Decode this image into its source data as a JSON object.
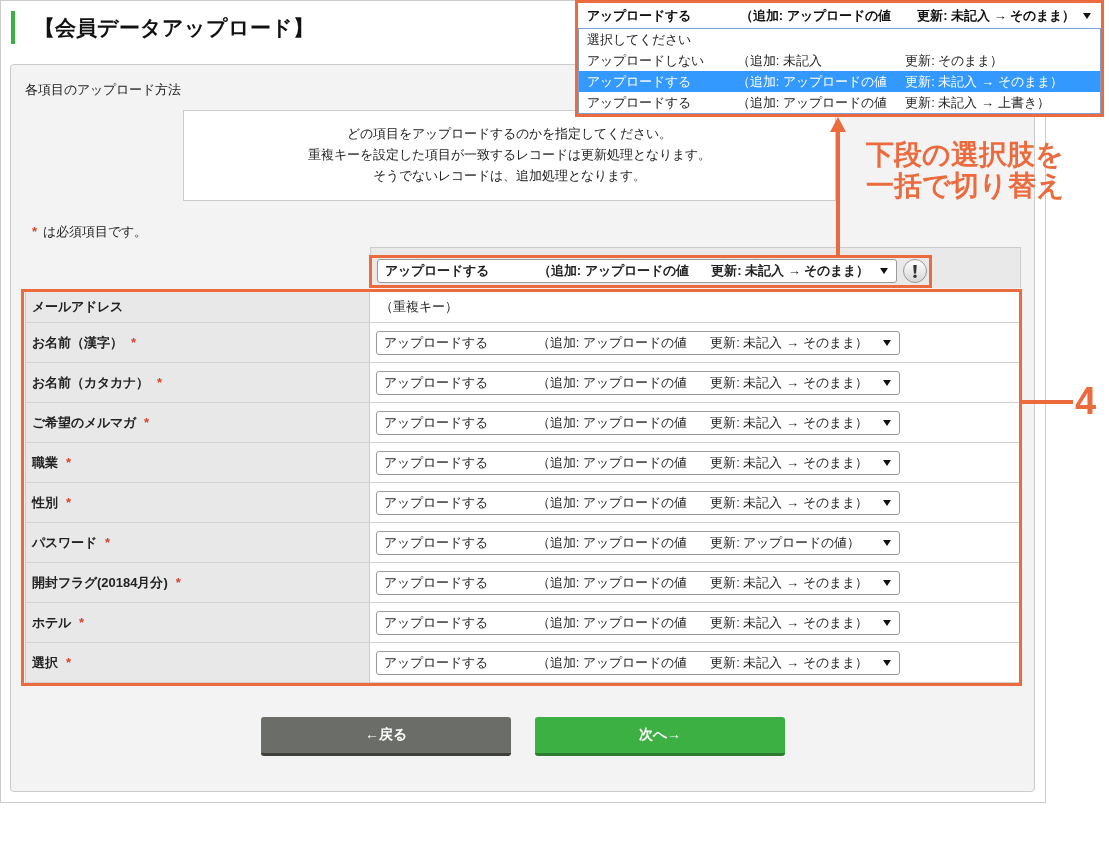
{
  "page_title": "【会員データアップロード】",
  "dropdown_popup": {
    "value_parts": [
      "アップロードする",
      "（追加: アップロードの値",
      "更新: 未記入 → そのまま）"
    ],
    "options": [
      {
        "parts": [
          "選択してください"
        ],
        "selected": false
      },
      {
        "parts": [
          "アップロードしない",
          "（追加: 未記入",
          "更新: そのまま）"
        ],
        "selected": false
      },
      {
        "parts": [
          "アップロードする",
          "（追加: アップロードの値",
          "更新: 未記入 → そのまま）"
        ],
        "selected": true
      },
      {
        "parts": [
          "アップロードする",
          "（追加: アップロードの値",
          "更新: 未記入 → 上書き）"
        ],
        "selected": false
      }
    ]
  },
  "section_label": "各項目のアップロード方法",
  "info_lines": [
    "どの項目をアップロードするのかを指定してください。",
    "重複キーを設定した項目が一致するレコードは更新処理となります。",
    "そうでないレコードは、追加処理となります。"
  ],
  "required_note": {
    "mark": "*",
    "text": "は必須項目です。"
  },
  "bulk_select": {
    "parts": [
      "アップロードする",
      "（追加: アップロードの値",
      "更新: 未記入 → そのまま）"
    ]
  },
  "fields": [
    {
      "label": "メールアドレス",
      "kind": "text",
      "value": "（重複キー）"
    },
    {
      "label": "お名前（漢字）",
      "mark": "*",
      "kind": "select",
      "parts": [
        "アップロードする",
        "（追加: アップロードの値",
        "更新: 未記入 → そのまま）"
      ]
    },
    {
      "label": "お名前（カタカナ）",
      "mark": "*",
      "kind": "select",
      "parts": [
        "アップロードする",
        "（追加: アップロードの値",
        "更新: 未記入 → そのまま）"
      ]
    },
    {
      "label": "ご希望のメルマガ",
      "mark": "*",
      "kind": "select",
      "parts": [
        "アップロードする",
        "（追加: アップロードの値",
        "更新: 未記入 → そのまま）"
      ]
    },
    {
      "label": "職業",
      "mark": "*",
      "kind": "select",
      "parts": [
        "アップロードする",
        "（追加: アップロードの値",
        "更新: 未記入 → そのまま）"
      ]
    },
    {
      "label": "性別",
      "mark": "*",
      "kind": "select",
      "parts": [
        "アップロードする",
        "（追加: アップロードの値",
        "更新: 未記入 → そのまま）"
      ]
    },
    {
      "label": "パスワード",
      "mark": "*",
      "kind": "select",
      "parts": [
        "アップロードする",
        "（追加: アップロードの値",
        "更新: アップロードの値）"
      ]
    },
    {
      "label": "開封フラグ(20184月分)",
      "mark": "*",
      "kind": "select",
      "parts": [
        "アップロードする",
        "（追加: アップロードの値",
        "更新: 未記入 → そのまま）"
      ]
    },
    {
      "label": "ホテル",
      "mark": "*",
      "kind": "select",
      "parts": [
        "アップロードする",
        "（追加: アップロードの値",
        "更新: 未記入 → そのまま）"
      ]
    },
    {
      "label": "選択",
      "mark": "*",
      "kind": "select",
      "parts": [
        "アップロードする",
        "（追加: アップロードの値",
        "更新: 未記入 → そのまま）"
      ]
    }
  ],
  "buttons": [
    {
      "label": "←戻る",
      "kind": "back"
    },
    {
      "label": "次へ→",
      "kind": "next"
    }
  ],
  "callouts": {
    "bulk_note": [
      "下段の選択肢を",
      "一括で切り替え"
    ],
    "row_count": "4"
  }
}
